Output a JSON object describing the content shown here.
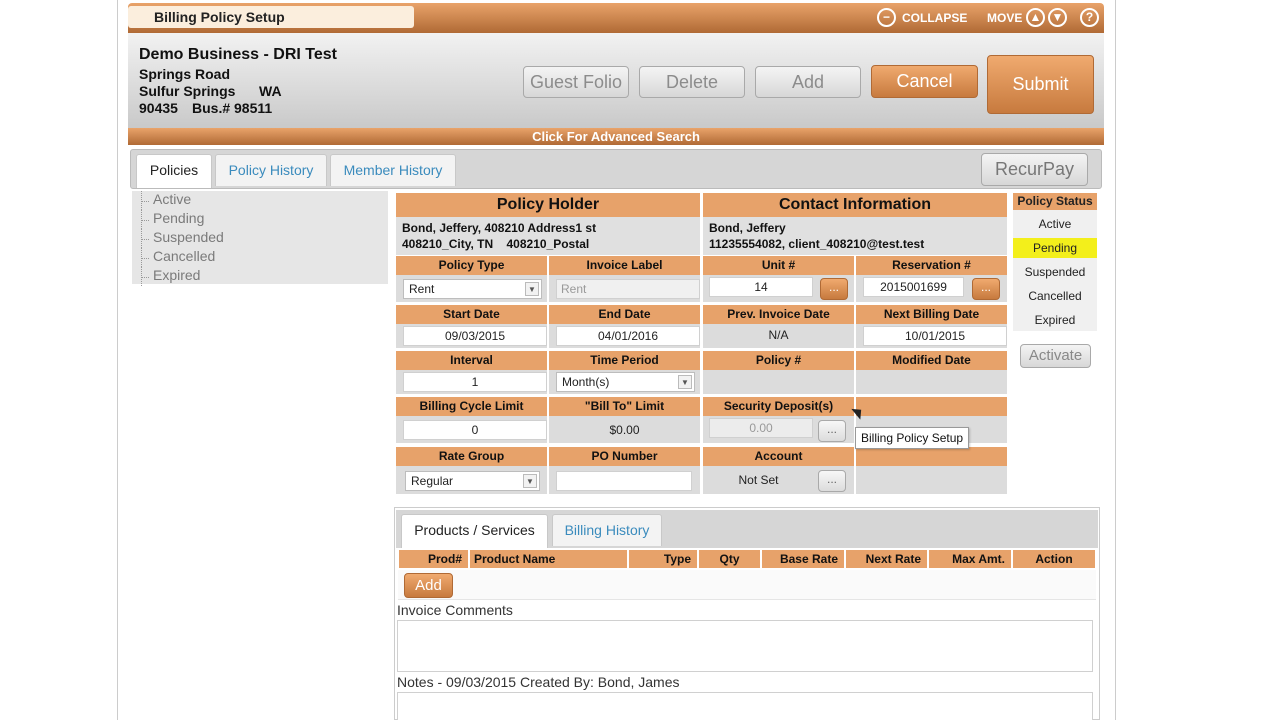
{
  "window": {
    "title": "Billing Policy Setup",
    "collapse_label": "COLLAPSE",
    "move_label": "MOVE",
    "help_symbol": "?"
  },
  "business": {
    "name": "Demo Business - DRI Test",
    "street": "Springs Road",
    "city": "Sulfur Springs",
    "state": "WA",
    "zip": "90435",
    "bus_no": "Bus.# 98511"
  },
  "toolbar": {
    "guest_folio": "Guest Folio",
    "delete": "Delete",
    "add": "Add",
    "cancel": "Cancel",
    "submit": "Submit"
  },
  "advanced_search": "Click For Advanced Search",
  "tabs": {
    "policies": "Policies",
    "policy_history": "Policy History",
    "member_history": "Member History",
    "recurpay": "RecurPay"
  },
  "tree": [
    "Active",
    "Pending",
    "Suspended",
    "Cancelled",
    "Expired"
  ],
  "policy_holder": {
    "header": "Policy Holder",
    "line1": "Bond, Jeffery, 408210 Address1 st",
    "line2": "408210_City, TN    408210_Postal"
  },
  "contact": {
    "header": "Contact Information",
    "line1": "Bond, Jeffery",
    "line2": "11235554082, client_408210@test.test"
  },
  "fields": {
    "policy_type": {
      "label": "Policy Type",
      "value": "Rent"
    },
    "invoice_label": {
      "label": "Invoice Label",
      "placeholder": "Rent"
    },
    "unit": {
      "label": "Unit #",
      "value": "14"
    },
    "reservation": {
      "label": "Reservation #",
      "value": "2015001699"
    },
    "start_date": {
      "label": "Start Date",
      "value": "09/03/2015"
    },
    "end_date": {
      "label": "End Date",
      "value": "04/01/2016"
    },
    "prev_invoice_date": {
      "label": "Prev. Invoice Date",
      "value": "N/A"
    },
    "next_billing_date": {
      "label": "Next Billing Date",
      "value": "10/01/2015"
    },
    "interval": {
      "label": "Interval",
      "value": "1"
    },
    "time_period": {
      "label": "Time Period",
      "value": "Month(s)"
    },
    "policy_no": {
      "label": "Policy #",
      "value": ""
    },
    "modified_date": {
      "label": "Modified Date",
      "value": ""
    },
    "billing_cycle_limit": {
      "label": "Billing Cycle Limit",
      "value": "0"
    },
    "bill_to_limit": {
      "label": "\"Bill To\" Limit",
      "value": "$0.00"
    },
    "security_deposit": {
      "label": "Security Deposit(s)",
      "value": "0.00"
    },
    "rate_group": {
      "label": "Rate Group",
      "value": "Regular"
    },
    "po_number": {
      "label": "PO Number",
      "value": ""
    },
    "account": {
      "label": "Account",
      "value": "Not Set"
    }
  },
  "dots_label": "...",
  "policy_status": {
    "header": "Policy Status",
    "items": [
      "Active",
      "Pending",
      "Suspended",
      "Cancelled",
      "Expired"
    ],
    "selected": "Pending",
    "activate": "Activate"
  },
  "tooltip": "Billing Policy Setup",
  "lower": {
    "tabs": {
      "products": "Products / Services",
      "billing_history": "Billing History"
    },
    "columns": [
      "Prod#",
      "Product Name",
      "Type",
      "Qty",
      "Base Rate",
      "Next Rate",
      "Max Amt.",
      "Action"
    ],
    "add": "Add",
    "invoice_comments": "Invoice Comments",
    "notes": "Notes - 09/03/2015 Created By: Bond, James"
  },
  "colors": {
    "accent_orange": "#e7a26a",
    "highlight_yellow": "#f3ef1b",
    "link_blue": "#3a8bbd"
  }
}
